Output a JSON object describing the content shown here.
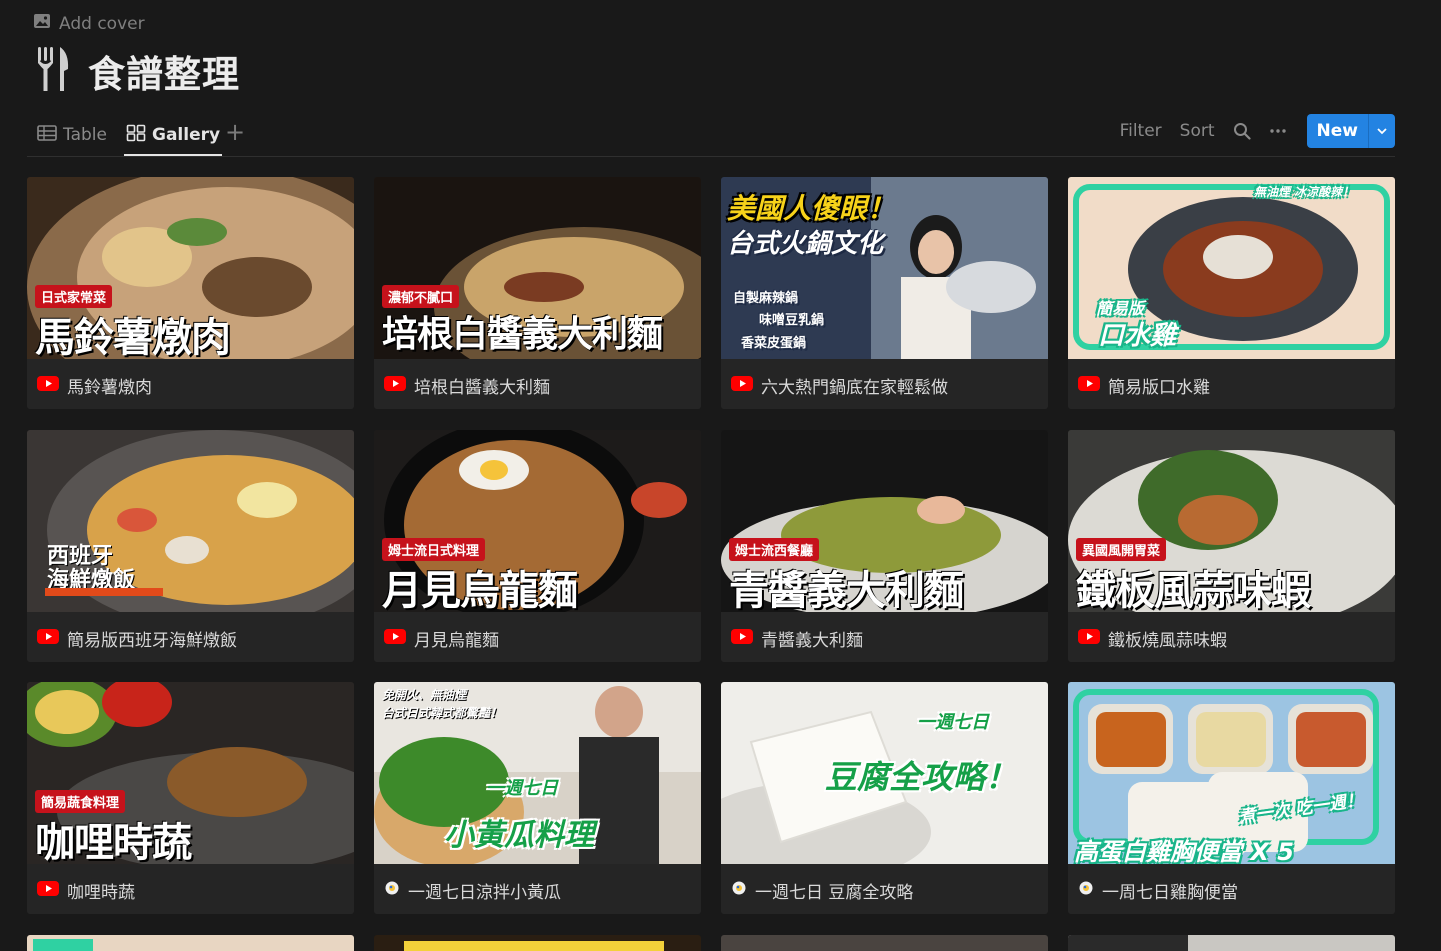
{
  "page": {
    "add_cover": "Add cover",
    "title": "食譜整理",
    "icon": "fork-knife-icon"
  },
  "views": {
    "table": "Table",
    "gallery": "Gallery",
    "active": "Gallery"
  },
  "toolbar": {
    "filter": "Filter",
    "sort": "Sort",
    "new": "New"
  },
  "colors": {
    "accent": "#2383e2",
    "background": "#191919",
    "card": "#252525",
    "youtube_red": "#ff0000"
  },
  "cards": [
    {
      "caption": "馬鈴薯燉肉",
      "source": "youtube",
      "overlay_tag": "日式家常菜",
      "overlay_title": "馬鈴薯燉肉"
    },
    {
      "caption": "培根白醬義大利麵",
      "source": "youtube",
      "overlay_tag": "濃郁不膩口",
      "overlay_title": "培根白醬義大利麵"
    },
    {
      "caption": "六大熱門鍋底在家輕鬆做",
      "source": "youtube",
      "overlay_title": "美國人傻眼！",
      "overlay_sub": "台式火鍋文化",
      "overlay_items": [
        "自製麻辣鍋",
        "味噌豆乳鍋",
        "香菜皮蛋鍋"
      ]
    },
    {
      "caption": "簡易版口水雞",
      "source": "youtube",
      "overlay_tag": "無油煙 冰涼酸辣！",
      "overlay_title": "口水雞",
      "overlay_sub": "簡易版"
    },
    {
      "caption": "簡易版西班牙海鮮燉飯",
      "source": "youtube",
      "overlay_title": "西班牙",
      "overlay_sub": "海鮮燉飯"
    },
    {
      "caption": "月見烏龍麵",
      "source": "youtube",
      "overlay_tag": "姆士流日式料理",
      "overlay_title": "月見烏龍麵"
    },
    {
      "caption": "青醬義大利麵",
      "source": "youtube",
      "overlay_tag": "姆士流西餐廳",
      "overlay_title": "青醬義大利麵"
    },
    {
      "caption": "鐵板燒風蒜味蝦",
      "source": "youtube",
      "overlay_tag": "異國風開胃菜",
      "overlay_title": "鐵板風蒜味蝦"
    },
    {
      "caption": "咖哩時蔬",
      "source": "youtube",
      "overlay_tag": "簡易蔬食料理",
      "overlay_title": "咖哩時蔬"
    },
    {
      "caption": "一週七日涼拌小黃瓜",
      "source": "web",
      "overlay_tag": "免開火、無油煙",
      "overlay_sub": "台式日式韓式都驚豔！",
      "overlay_small": "一週七日",
      "overlay_title": "小黃瓜料理"
    },
    {
      "caption": "一週七日 豆腐全攻略",
      "source": "web",
      "overlay_small": "一週七日",
      "overlay_title": "豆腐全攻略！"
    },
    {
      "caption": "一周七日雞胸便當",
      "source": "web",
      "overlay_small": "煮一次 吃一週！",
      "overlay_title": "高蛋白雞胸便當 X 5"
    }
  ]
}
